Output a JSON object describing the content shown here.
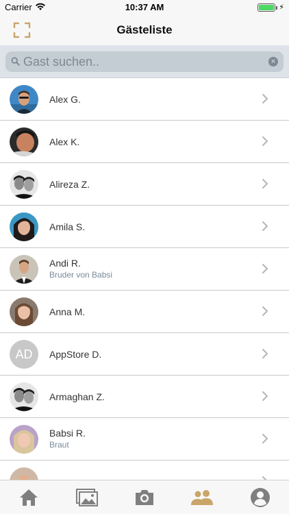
{
  "status_bar": {
    "carrier": "Carrier",
    "time": "10:37 AM",
    "battery_level": 1.0
  },
  "nav": {
    "title": "Gästeliste",
    "left_icon": "scan-icon"
  },
  "search": {
    "placeholder": "Gast suchen..",
    "value": ""
  },
  "guests": [
    {
      "name": "Alex G.",
      "subtitle": "",
      "avatar": "photo"
    },
    {
      "name": "Alex K.",
      "subtitle": "",
      "avatar": "photo"
    },
    {
      "name": "Alireza Z.",
      "subtitle": "",
      "avatar": "photo"
    },
    {
      "name": "Amila S.",
      "subtitle": "",
      "avatar": "photo"
    },
    {
      "name": "Andi R.",
      "subtitle": "Bruder von Babsi",
      "avatar": "photo"
    },
    {
      "name": "Anna M.",
      "subtitle": "",
      "avatar": "photo"
    },
    {
      "name": "AppStore D.",
      "subtitle": "",
      "avatar": "initials",
      "initials": "AD"
    },
    {
      "name": "Armaghan Z.",
      "subtitle": "",
      "avatar": "photo"
    },
    {
      "name": "Babsi R.",
      "subtitle": "Braut",
      "avatar": "photo"
    }
  ],
  "tabs": [
    {
      "name": "home",
      "icon": "home-icon",
      "active": false
    },
    {
      "name": "gallery",
      "icon": "images-icon",
      "active": false
    },
    {
      "name": "camera",
      "icon": "camera-icon",
      "active": false
    },
    {
      "name": "guests",
      "icon": "people-icon",
      "active": true
    },
    {
      "name": "profile",
      "icon": "account-icon",
      "active": false
    }
  ],
  "colors": {
    "accent": "#c9a56a",
    "inactive_icon": "#7f7f7f",
    "subtitle": "#7a8a99",
    "search_bg": "#dde3e9"
  }
}
